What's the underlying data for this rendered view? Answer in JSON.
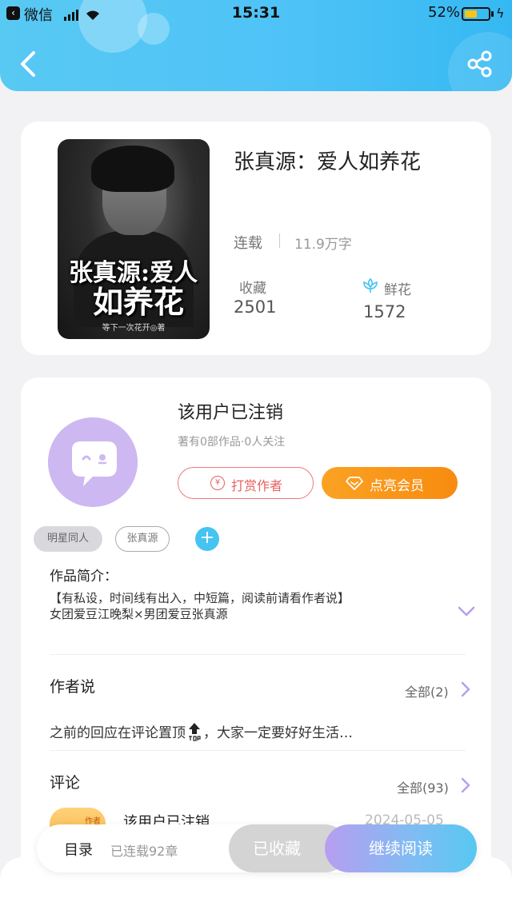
{
  "status_bar": {
    "back_glyph": "‹",
    "app": "微信",
    "time": "15:31",
    "battery": "52%",
    "battery_level": 0.52,
    "charging_glyph": "ϟ"
  },
  "header": {
    "back_icon": "chevron-left-icon",
    "share_icon": "share-icon",
    "accent": "#4fc3f7"
  },
  "book": {
    "title": "张真源：爱人如养花",
    "status": "连载",
    "word_count": "11.9万字",
    "favorites_label": "收藏",
    "favorites_value": "2501",
    "flowers_label": "鲜花",
    "flowers_value": "1572",
    "cover": {
      "title_line1": "张真源:爱人",
      "title_line2": "如养花",
      "author": "等下一次花开◎著"
    }
  },
  "author": {
    "name": "该用户已注销",
    "meta": "著有0部作品·0人关注",
    "tip_glyph": "¥",
    "tip_button": "打赏作者",
    "vip_button": "点亮会员"
  },
  "tags": [
    {
      "label": "明星同人"
    },
    {
      "label": "张真源"
    }
  ],
  "add_tag_glyph": "+",
  "intro": {
    "title": "作品简介：",
    "line1": "【有私设，时间线有出入，中短篇，阅读前请看作者说】",
    "line2": "女团爱豆江晚梨×男团爱豆张真源"
  },
  "author_says": {
    "title": "作者说",
    "all": "全部(2)",
    "text_before": "之前的回应在评论置顶",
    "text_after": "，大家一定要好好生活…"
  },
  "comments": {
    "title": "评论",
    "all": "全部(93)",
    "first": {
      "badge": "作者",
      "user": "该用户已注销",
      "date": "2024-05-05"
    }
  },
  "bottom_bar": {
    "toc": "目录",
    "chapters": "已连载92章",
    "collected": "已收藏",
    "continue": "继续阅读"
  }
}
